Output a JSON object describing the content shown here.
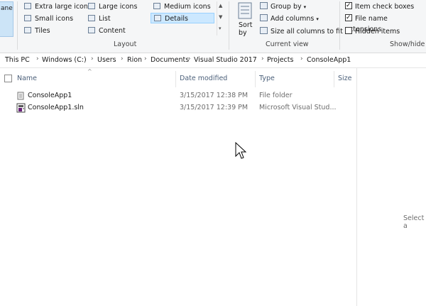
{
  "ribbon": {
    "pane_button_label": "ane",
    "layout_group": {
      "label": "Layout",
      "items": [
        {
          "label": "Extra large icons",
          "icon": "extra-large-icons-icon"
        },
        {
          "label": "Large icons",
          "icon": "large-icons-icon"
        },
        {
          "label": "Medium icons",
          "icon": "medium-icons-icon"
        },
        {
          "label": "Small icons",
          "icon": "small-icons-icon"
        },
        {
          "label": "List",
          "icon": "list-icon"
        },
        {
          "label": "Details",
          "icon": "details-icon",
          "selected": true
        },
        {
          "label": "Tiles",
          "icon": "tiles-icon"
        },
        {
          "label": "Content",
          "icon": "content-icon"
        }
      ]
    },
    "current_view_group": {
      "label": "Current view",
      "sort_by_label": "Sort",
      "sort_by_label2": "by",
      "group_by_label": "Group by",
      "add_columns_label": "Add columns",
      "size_columns_label": "Size all columns to fit"
    },
    "show_hide_group": {
      "label": "Show/hide",
      "item_check_boxes": {
        "label": "Item check boxes",
        "checked": true
      },
      "file_name_extensions": {
        "label": "File name extensions",
        "checked": true
      },
      "hidden_items": {
        "label": "Hidden items",
        "checked": false
      }
    }
  },
  "address_bar": {
    "crumbs": [
      "This PC",
      "Windows (C:)",
      "Users",
      "Rion",
      "Documents",
      "Visual Studio 2017",
      "Projects",
      "ConsoleApp1"
    ]
  },
  "file_list": {
    "columns": {
      "name": "Name",
      "date": "Date modified",
      "type": "Type",
      "size": "Size"
    },
    "rows": [
      {
        "name": "ConsoleApp1",
        "date": "3/15/2017 12:38 PM",
        "type": "File folder",
        "icon": "folder-icon"
      },
      {
        "name": "ConsoleApp1.sln",
        "date": "3/15/2017 12:39 PM",
        "type": "Microsoft Visual Stud...",
        "icon": "visual-studio-solution-icon"
      }
    ]
  },
  "details_pane": {
    "text": "Select a"
  },
  "colors": {
    "accent": "#cce8ff",
    "header_text": "#4c607a"
  }
}
